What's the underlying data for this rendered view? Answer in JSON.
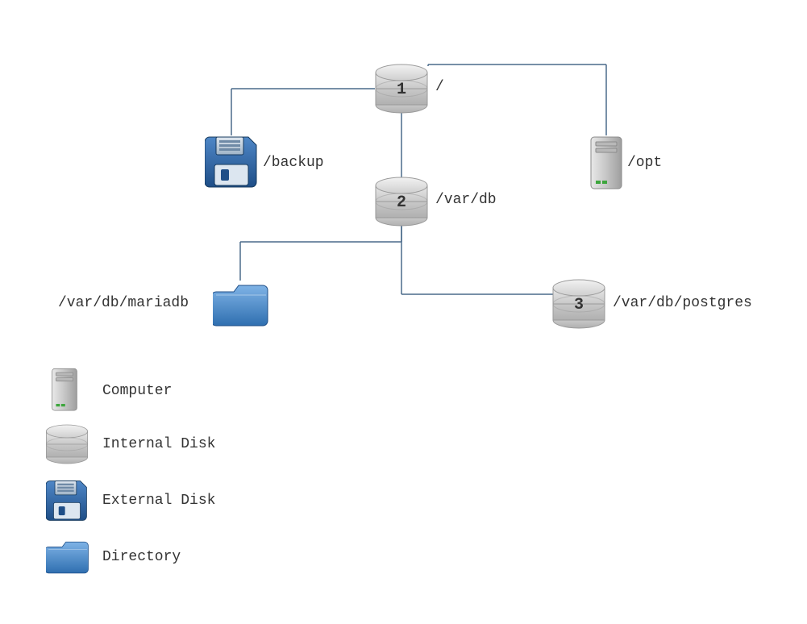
{
  "nodes": {
    "root": {
      "label": "/",
      "num": "1"
    },
    "backup": {
      "label": "/backup"
    },
    "opt": {
      "label": "/opt"
    },
    "vardb": {
      "label": "/var/db",
      "num": "2"
    },
    "mariadb": {
      "label": "/var/db/mariadb"
    },
    "postgres": {
      "label": "/var/db/postgres",
      "num": "3"
    }
  },
  "legend": {
    "computer": "Computer",
    "internal_disk": "Internal Disk",
    "external_disk": "External Disk",
    "directory": "Directory"
  }
}
